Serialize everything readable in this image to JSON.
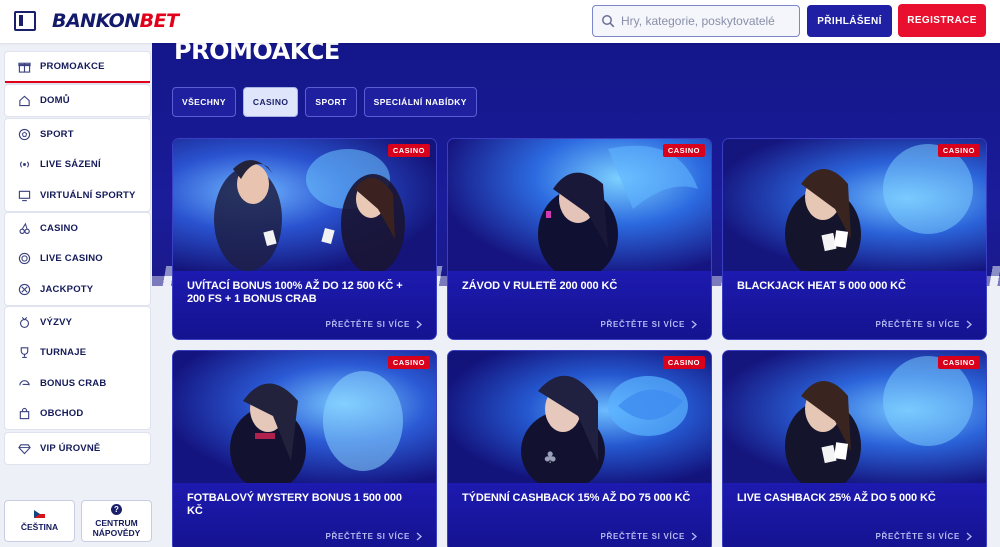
{
  "header": {
    "logo_part1": "BANKON",
    "logo_part2": "BET",
    "search_placeholder": "Hry, kategorie, poskytovatelé",
    "login_label": "PŘIHLÁŠENÍ",
    "register_label": "REGISTRACE"
  },
  "sidebar": {
    "promo": [
      {
        "label": "PROMOAKCE",
        "icon": "gift-icon"
      }
    ],
    "home": [
      {
        "label": "DOMŮ",
        "icon": "home-icon"
      }
    ],
    "sports": [
      {
        "label": "SPORT",
        "icon": "ball-icon"
      },
      {
        "label": "LIVE SÁZENÍ",
        "icon": "live-icon"
      },
      {
        "label": "VIRTUÁLNÍ SPORTY",
        "icon": "monitor-icon"
      }
    ],
    "casino": [
      {
        "label": "CASINO",
        "icon": "cherry-icon"
      },
      {
        "label": "LIVE CASINO",
        "icon": "chip-icon"
      },
      {
        "label": "JACKPOTY",
        "icon": "jackpot-icon"
      }
    ],
    "extras": [
      {
        "label": "VÝZVY",
        "icon": "medal-icon"
      },
      {
        "label": "TURNAJE",
        "icon": "trophy-icon"
      },
      {
        "label": "BONUS CRAB",
        "icon": "crab-icon"
      },
      {
        "label": "OBCHOD",
        "icon": "bag-icon"
      }
    ],
    "vip": [
      {
        "label": "VIP ÚROVNĚ",
        "icon": "diamond-icon"
      }
    ],
    "language_label": "ČEŠTINA",
    "help_label_1": "CENTRUM",
    "help_label_2": "NÁPOVĚDY"
  },
  "main": {
    "title": "PROMOAKCE",
    "filters": [
      "VŠECHNY",
      "CASINO",
      "SPORT",
      "SPECIÁLNÍ NABÍDKY"
    ],
    "active_filter": "CASINO",
    "read_more": "PŘEČTĚTE SI VÍCE",
    "cards": [
      {
        "tag": "CASINO",
        "title": "UVÍTACÍ BONUS 100% AŽ DO 12 500 KČ + 200 FS + 1 BONUS CRAB"
      },
      {
        "tag": "CASINO",
        "title": "ZÁVOD V RULETĚ 200 000 KČ"
      },
      {
        "tag": "CASINO",
        "title": "BLACKJACK HEAT 5 000 000 KČ"
      },
      {
        "tag": "CASINO",
        "title": "FOTBALOVÝ MYSTERY BONUS 1 500 000 KČ"
      },
      {
        "tag": "CASINO",
        "title": "TÝDENNÍ CASHBACK 15% AŽ DO 75 000 KČ"
      },
      {
        "tag": "CASINO",
        "title": "LIVE CASHBACK 25% AŽ DO 5 000 KČ"
      }
    ]
  },
  "colors": {
    "brand_navy": "#13196b",
    "brand_red": "#e3001b",
    "login_blue": "#1f20a3",
    "card_blue": "#1b1ba6"
  }
}
